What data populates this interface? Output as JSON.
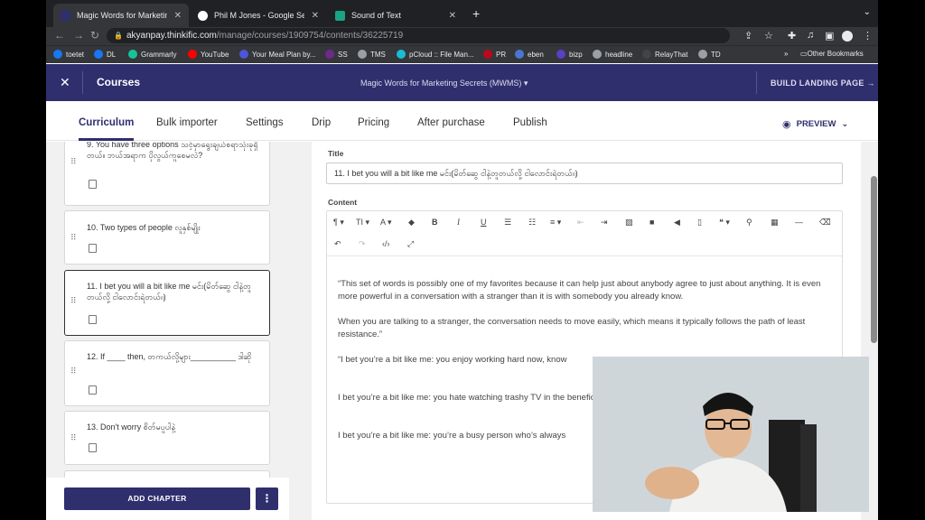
{
  "tabs": [
    {
      "title": "Magic Words for Marketing Sec",
      "favicon_color": "#2f2f6e",
      "active": true
    },
    {
      "title": "Phil M Jones - Google Search",
      "favicon_color": "#ffffff",
      "active": false
    },
    {
      "title": "Sound of Text",
      "favicon_color": "#1aa384",
      "active": false
    }
  ],
  "address": {
    "host": "akyanpay.thinkific.com",
    "path": "/manage/courses/1909754/contents/36225719"
  },
  "bookmarks": [
    {
      "label": "toetet",
      "color": "#1877f2"
    },
    {
      "label": "DL",
      "color": "#1877f2"
    },
    {
      "label": "Grammarly",
      "color": "#15c39a"
    },
    {
      "label": "YouTube",
      "color": "#ff0000"
    },
    {
      "label": "Your Meal Plan by...",
      "color": "#4e55d9"
    },
    {
      "label": "SS",
      "color": "#6e2a8a"
    },
    {
      "label": "TMS",
      "color": "#9aa0a6"
    },
    {
      "label": "pCloud :: File Man...",
      "color": "#17bed0"
    },
    {
      "label": "PR",
      "color": "#bd081c"
    },
    {
      "label": "eben",
      "color": "#4a76d1"
    },
    {
      "label": "bizp",
      "color": "#5b3fc4"
    },
    {
      "label": "headline",
      "color": "#9aa0a6"
    },
    {
      "label": "RelayThat",
      "color": "#444"
    },
    {
      "label": "TD",
      "color": "#9aa0a6"
    }
  ],
  "bookmarks_more": "»",
  "other_bookmarks": "Other Bookmarks",
  "header": {
    "close": "✕",
    "section": "Courses",
    "course_title": "Magic Words for Marketing Secrets (MWMS) ▾",
    "build_landing": "BUILD LANDING PAGE →"
  },
  "nav_tabs": [
    "Curriculum",
    "Bulk importer",
    "Settings",
    "Drip",
    "Pricing",
    "After purchase",
    "Publish"
  ],
  "preview": "PREVIEW",
  "lessons": [
    {
      "title": "9. You have three options သင့်မှာရွေးချယ်စရာသုံးခုရှိတယ်။ ဘယ်အရာက ပိုလွယ်ကူစေမလဲ?"
    },
    {
      "title": "10. Two types of people လူနှစ်မျိုး"
    },
    {
      "title": "11. I bet you will a bit like me မင်း(မိတ်ဆွေ ငါနဲ့တူတယ်လို့ ငါလောင်းရဲတယ်။)"
    },
    {
      "title": "12. If ____ then, တကယ်လို့များ__________ ဒါဆို"
    },
    {
      "title": "13. Don't worry စိတ်မပူပါနဲ့"
    }
  ],
  "add_chapter": "ADD CHAPTER",
  "more": "⋮",
  "editor": {
    "title_label": "Title",
    "title_value": "11. I bet you will a bit like me မင်း(မိတ်ဆွေ ငါနဲ့တူတယ်လို့ ငါလောင်းရဲတယ်။)",
    "content_label": "Content",
    "paragraphs": [
      "“This set of words is possibly one of my favorites because it can help just about anybody agree to just about anything. It is even more powerful in a conversation with a stranger than it is with somebody you already know.",
      "When you are talking to a stranger, the conversation needs to move easily, which means it typically follows the path of least resistance.”",
      "“I bet you’re a bit like me: you enjoy working hard now, know",
      "I bet you’re a bit like me: you hate watching trashy TV in the beneficial.",
      "I bet you’re a bit like me: you’re a busy person who’s always"
    ]
  }
}
